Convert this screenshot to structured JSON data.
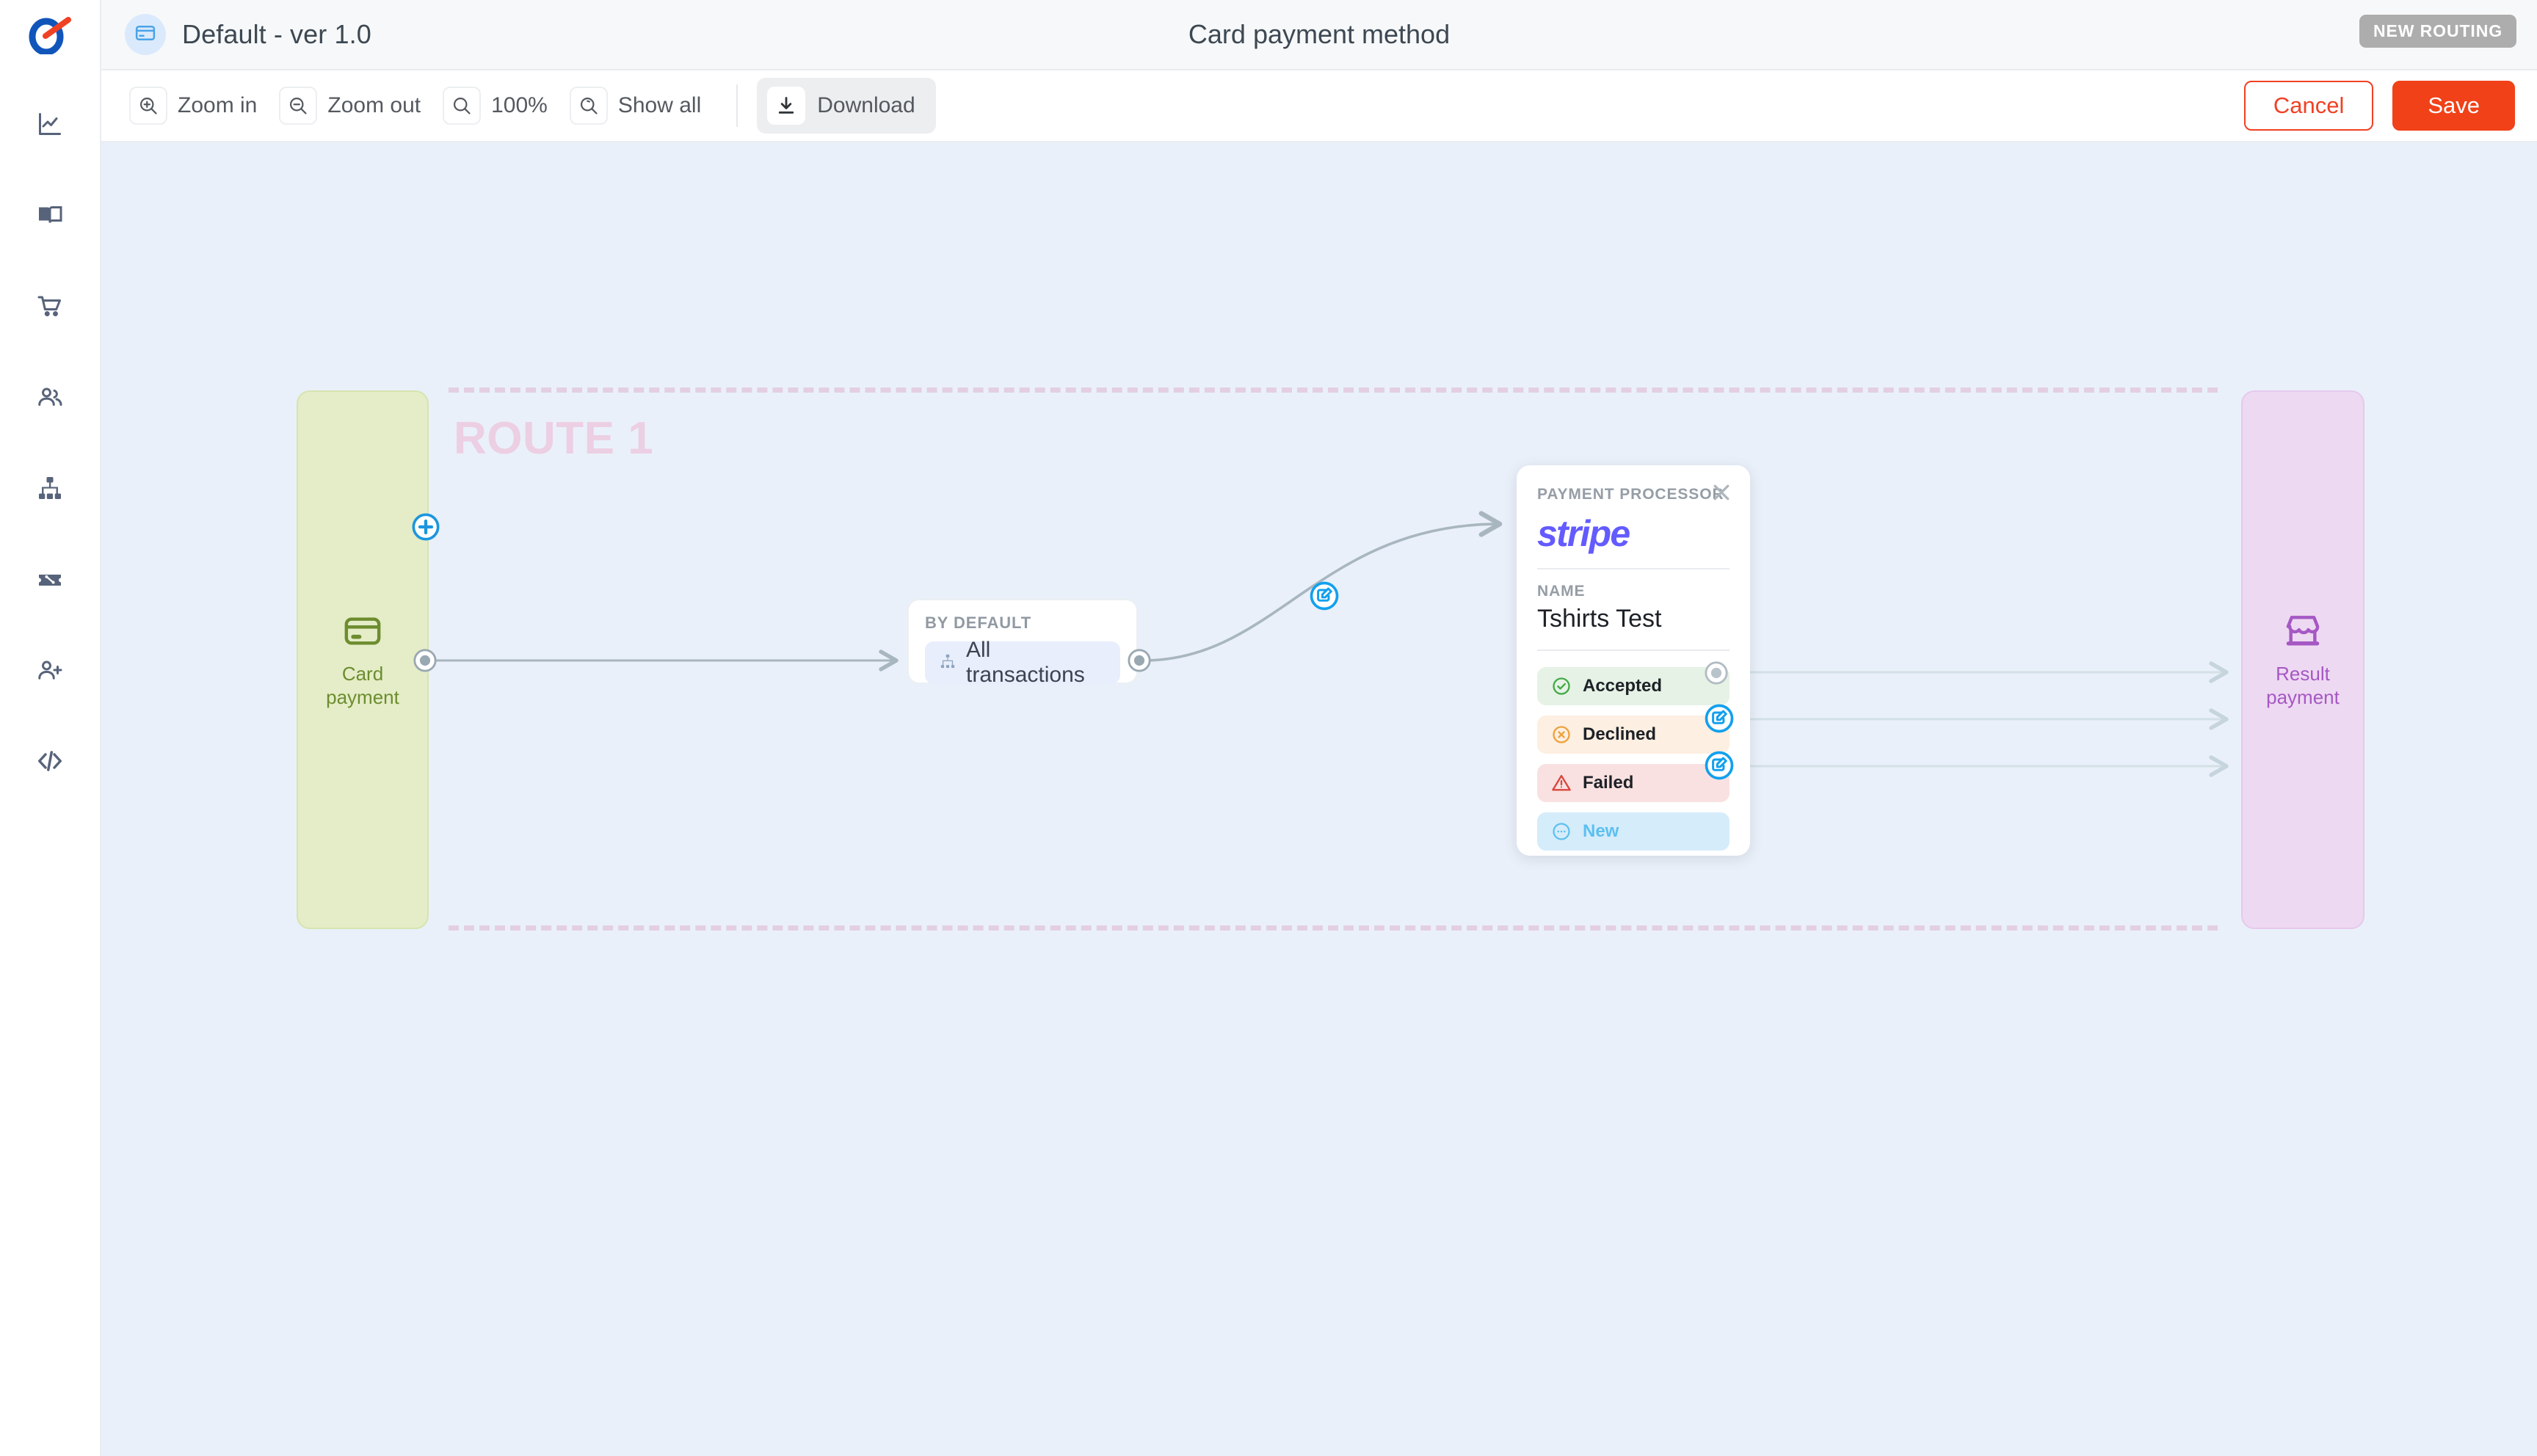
{
  "app": {
    "logo_name": "target-logo"
  },
  "sidebar": {
    "items": [
      {
        "icon": "analytics-chart-icon",
        "name": "sidebar-item-analytics"
      },
      {
        "icon": "book-icon",
        "name": "sidebar-item-catalog"
      },
      {
        "icon": "shopping-cart-icon",
        "name": "sidebar-item-orders"
      },
      {
        "icon": "users-icon",
        "name": "sidebar-item-customers"
      },
      {
        "icon": "sitemap-icon",
        "name": "sidebar-item-routing"
      },
      {
        "icon": "discount-ticket-icon",
        "name": "sidebar-item-promotions"
      },
      {
        "icon": "add-user-icon",
        "name": "sidebar-item-team"
      },
      {
        "icon": "code-icon",
        "name": "sidebar-item-developers"
      }
    ]
  },
  "header": {
    "doc_icon": "credit-card-icon",
    "doc_title": "Default - ver 1.0",
    "page_title": "Card payment method",
    "routing_badge": "NEW ROUTING"
  },
  "toolbar": {
    "zoom_in": "Zoom in",
    "zoom_out": "Zoom out",
    "zoom_level": "100%",
    "show_all": "Show all",
    "download": "Download",
    "cancel": "Cancel",
    "save": "Save"
  },
  "canvas": {
    "route_label": "ROUTE 1",
    "start_node": {
      "icon": "credit-card-icon",
      "label_line1": "Card",
      "label_line2": "payment"
    },
    "end_node": {
      "icon": "storefront-icon",
      "label_line1": "Result",
      "label_line2": "payment"
    },
    "condition_node": {
      "caption": "BY DEFAULT",
      "chip_icon": "sitemap-small-icon",
      "chip_label": "All transactions"
    },
    "processor_card": {
      "caption": "PAYMENT PROCESSOR",
      "logo_text": "stripe",
      "close_icon": "close-icon",
      "name_caption": "NAME",
      "name_value": "Tshirts Test",
      "statuses": [
        {
          "label": "Accepted",
          "icon": "check-circle-icon",
          "style": "accepted",
          "handle": "dot"
        },
        {
          "label": "Declined",
          "icon": "x-circle-icon",
          "style": "declined",
          "handle": "edit"
        },
        {
          "label": "Failed",
          "icon": "warning-triangle-icon",
          "style": "failed",
          "handle": "edit"
        },
        {
          "label": "New",
          "icon": "dots-circle-icon",
          "style": "new",
          "handle": "none"
        }
      ]
    },
    "handles": {
      "add_branch": "add-branch-button",
      "edit_connection": "edit-connection-button"
    }
  },
  "colors": {
    "accent_orange": "#f14118",
    "canvas_bg": "#eaf0f9",
    "route_dash": "#e3cfe1",
    "start_lane": "#e4edc7",
    "end_lane": "#eed9f2",
    "stripe_purple": "#635bff",
    "edit_blue": "#12a0ee"
  }
}
